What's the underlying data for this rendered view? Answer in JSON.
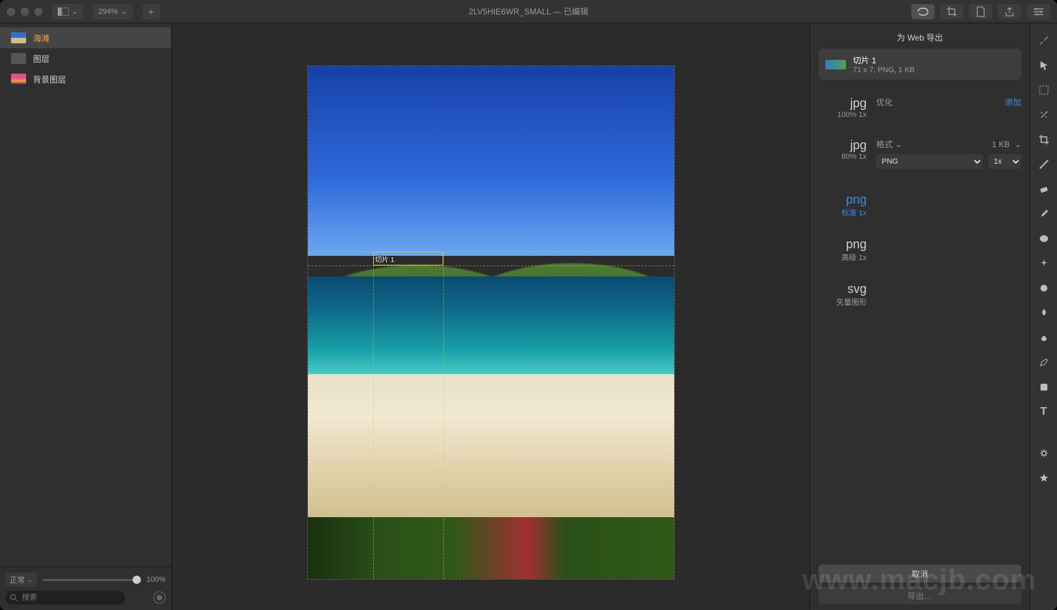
{
  "window": {
    "title": "2LV5HIE6WR_SMALL — 已编辑",
    "zoom": "294%"
  },
  "toolbar_left": {
    "view_menu": "view",
    "add_tab": "+"
  },
  "toolbar_right_icons": [
    "lasso-icon",
    "crop-icon",
    "page-icon",
    "share-icon",
    "settings-icon"
  ],
  "layers": [
    {
      "name": "海滩",
      "selected": true,
      "thumb": "beach"
    },
    {
      "name": "图层",
      "selected": false,
      "thumb": "gray"
    },
    {
      "name": "背景图层",
      "selected": false,
      "thumb": "sunset"
    }
  ],
  "layers_footer": {
    "blend_mode": "正常",
    "opacity_label": "100%",
    "search_placeholder": "搜索"
  },
  "canvas": {
    "slice_label": "切片 1"
  },
  "export": {
    "title": "为 Web 导出",
    "slice": {
      "name": "切片 1",
      "detail": "71 x 7, PNG, 1 KB"
    },
    "optimize_label": "优化",
    "add_label": "添加",
    "format_label": "格式",
    "size_label": "1 KB",
    "format_value": "PNG",
    "scale_value": "1x",
    "presets": [
      {
        "big": "jpg",
        "sub": "100% 1x",
        "selected": false
      },
      {
        "big": "jpg",
        "sub": "80% 1x",
        "selected": false
      },
      {
        "big": "png",
        "sub": "标准 1x",
        "selected": true
      },
      {
        "big": "png",
        "sub": "高级 1x",
        "selected": false
      },
      {
        "big": "svg",
        "sub": "矢量图形",
        "selected": false
      }
    ],
    "cancel": "取消",
    "export_btn": "导出…"
  },
  "tools": [
    "brush-icon",
    "arrow-icon",
    "marquee-icon",
    "magic-wand-icon",
    "crop-tool-icon",
    "line-icon",
    "eraser-icon",
    "color-picker-icon",
    "shape-oval-icon",
    "sparkle-icon",
    "blob-icon",
    "flame-icon",
    "smudge-icon",
    "pen-icon",
    "rect-icon",
    "text-icon",
    "divider",
    "gear-icon",
    "star-icon"
  ],
  "watermark": "www.macjb.com"
}
